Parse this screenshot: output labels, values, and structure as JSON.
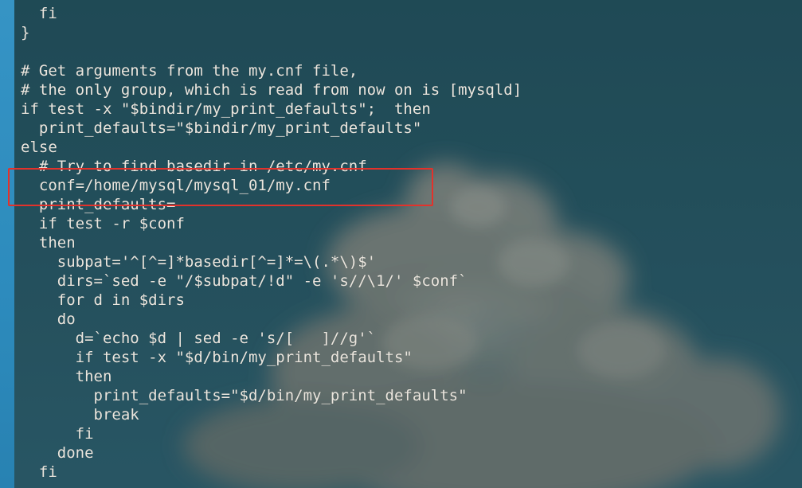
{
  "terminal": {
    "lines": [
      "  fi",
      "}",
      "",
      "# Get arguments from the my.cnf file,",
      "# the only group, which is read from now on is [mysqld]",
      "if test -x \"$bindir/my_print_defaults\";  then",
      "  print_defaults=\"$bindir/my_print_defaults\"",
      "else",
      "  # Try to find basedir in /etc/my.cnf",
      "  conf=/home/mysql/mysql_01/my.cnf",
      "  print_defaults=",
      "  if test -r $conf",
      "  then",
      "    subpat='^[^=]*basedir[^=]*=\\(.*\\)$'",
      "    dirs=`sed -e \"/$subpat/!d\" -e 's//\\1/' $conf`",
      "    for d in $dirs",
      "    do",
      "      d=`echo $d | sed -e 's/[   ]//g'`",
      "      if test -x \"$d/bin/my_print_defaults\"",
      "      then",
      "        print_defaults=\"$d/bin/my_print_defaults\"",
      "        break",
      "      fi",
      "    done",
      "  fi"
    ]
  },
  "colors": {
    "background": "#24505c",
    "text": "#ebe6de",
    "left_strip": "#2f97cf",
    "highlight_border": "#e3322b"
  }
}
